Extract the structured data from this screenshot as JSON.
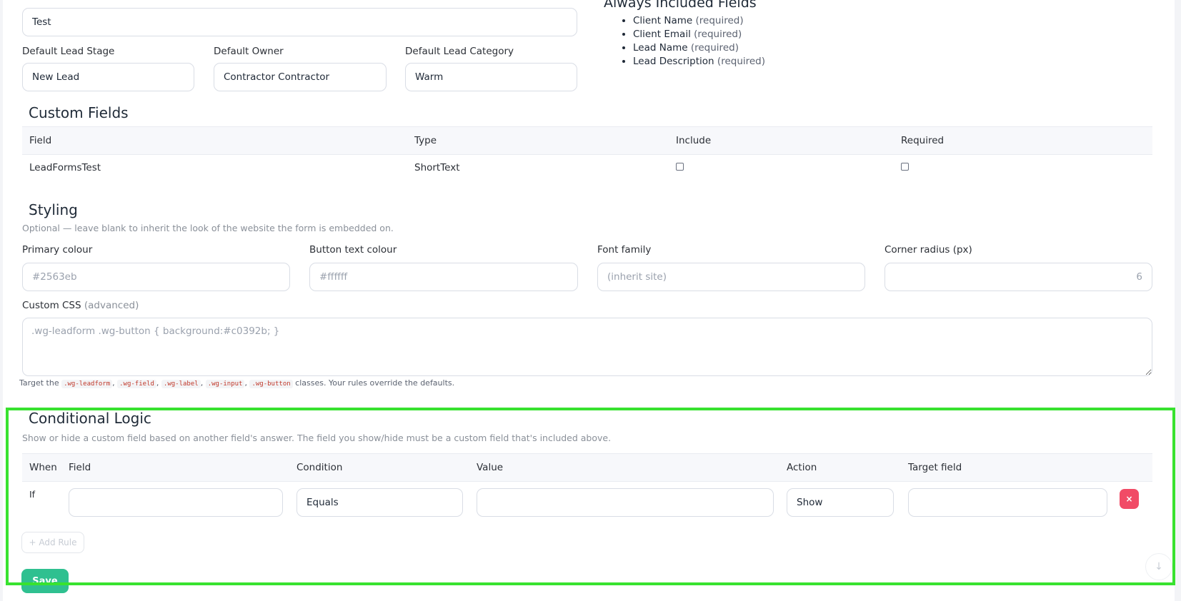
{
  "form": {
    "name_value": "Test",
    "default_stage_label": "Default Lead Stage",
    "default_stage_value": "New Lead",
    "default_owner_label": "Default Owner",
    "default_owner_value": "Contractor Contractor",
    "default_category_label": "Default Lead Category",
    "default_category_value": "Warm"
  },
  "always_included": {
    "title": "Always Included Fields",
    "items": [
      {
        "name": "Client Name",
        "note": "(required)"
      },
      {
        "name": "Client Email",
        "note": "(required)"
      },
      {
        "name": "Lead Name",
        "note": "(required)"
      },
      {
        "name": "Lead Description",
        "note": "(required)"
      }
    ]
  },
  "custom_fields": {
    "title": "Custom Fields",
    "columns": [
      "Field",
      "Type",
      "Include",
      "Required"
    ],
    "rows": [
      {
        "field": "LeadFormsTest",
        "type": "ShortText",
        "include": false,
        "required": false
      }
    ]
  },
  "styling": {
    "title": "Styling",
    "subtitle": "Optional — leave blank to inherit the look of the website the form is embedded on.",
    "primary_label": "Primary colour",
    "primary_placeholder": "#2563eb",
    "button_text_label": "Button text colour",
    "button_text_placeholder": "#ffffff",
    "font_label": "Font family",
    "font_placeholder": "(inherit site)",
    "radius_label": "Corner radius (px)",
    "radius_placeholder": "6",
    "custom_css_label": "Custom CSS",
    "custom_css_hint": "(advanced)",
    "custom_css_placeholder": ".wg-leadform .wg-button { background:#c0392b; }",
    "helper_prefix": "Target the",
    "helper_classes": [
      ".wg-leadform",
      ".wg-field",
      ".wg-label",
      ".wg-input",
      ".wg-button"
    ],
    "helper_suffix": "classes. Your rules override the defaults."
  },
  "conditional": {
    "title": "Conditional Logic",
    "subtitle": "Show or hide a custom field based on another field's answer. The field you show/hide must be a custom field that's included above.",
    "columns": {
      "when": "When",
      "field": "Field",
      "condition": "Condition",
      "value": "Value",
      "action": "Action",
      "target": "Target field"
    },
    "rule": {
      "when": "If",
      "field": "",
      "condition": "Equals",
      "value": "",
      "action": "Show",
      "target": ""
    },
    "delete_icon": "×",
    "add_rule_label": "+ Add Rule"
  },
  "actions": {
    "save_label": "Save",
    "scroll_icon": "↓"
  },
  "colors": {
    "highlight": "#38e22f",
    "save": "#2fc090",
    "delete": "#f14b66"
  }
}
